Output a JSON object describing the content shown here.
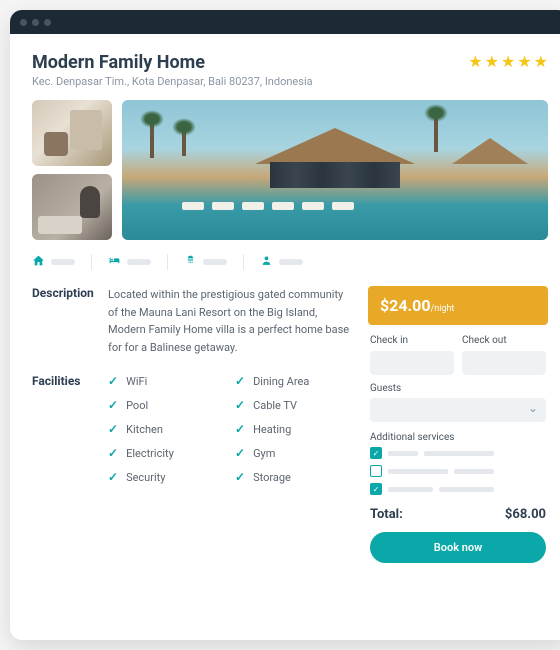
{
  "header": {
    "title": "Modern Family Home",
    "address": "Kec. Denpasar Tim., Kota Denpasar, Bali 80237, Indonesia",
    "rating_stars": 5
  },
  "description": {
    "label": "Description",
    "text": "Located within the prestigious gated community of the Mauna Lani Resort on the Big Island, Modern Family Home villa is a perfect home base for for a Balinese getaway."
  },
  "facilities": {
    "label": "Facilities",
    "items": [
      "WiFi",
      "Dining Area",
      "Pool",
      "Cable TV",
      "Kitchen",
      "Heating",
      "Electricity",
      "Gym",
      "Security",
      "Storage"
    ]
  },
  "booking": {
    "price": "$24.00",
    "unit": "/night",
    "checkin_label": "Check in",
    "checkout_label": "Check out",
    "guests_label": "Guests",
    "additional_label": "Additional services",
    "additional_services": [
      {
        "checked": true
      },
      {
        "checked": false
      },
      {
        "checked": true
      }
    ],
    "total_label": "Total:",
    "total_value": "$68.00",
    "book_button": "Book now"
  }
}
